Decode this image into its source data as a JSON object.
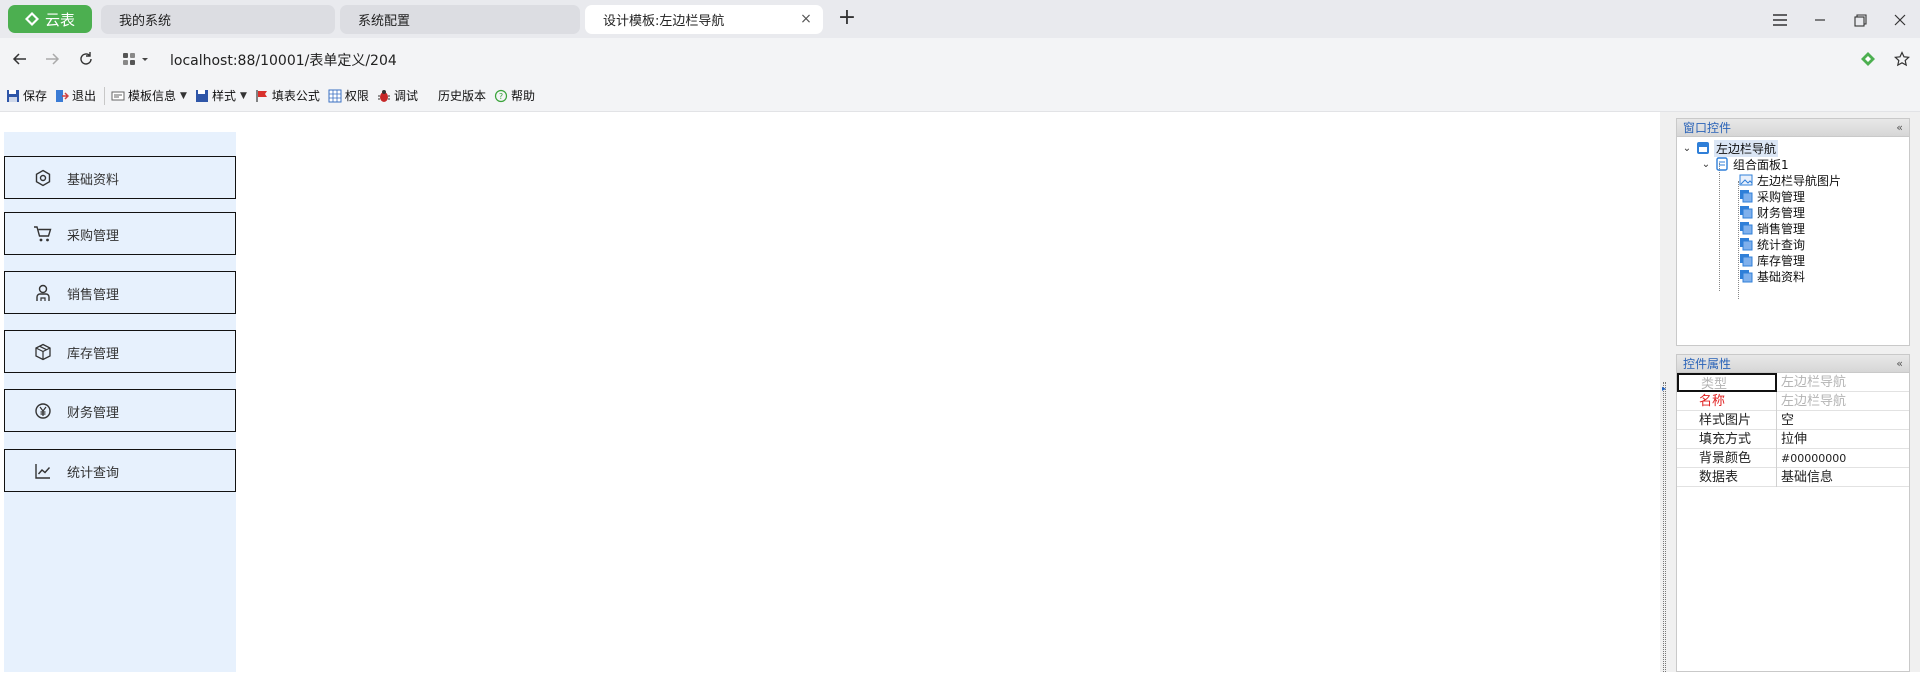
{
  "browser": {
    "app_button_label": "云表",
    "tabs": [
      {
        "label": "我的系统",
        "active": false
      },
      {
        "label": "系统配置",
        "active": false
      },
      {
        "label": "设计模板:左边栏导航",
        "active": true
      }
    ],
    "close_glyph": "×",
    "new_tab_glyph": "+",
    "url": "localhost:88/10001/表单定义/204"
  },
  "toolbar": {
    "save": "保存",
    "exit": "退出",
    "template_info": "模板信息",
    "style": "样式",
    "fill_formula": "填表公式",
    "permission": "权限",
    "debug": "调试",
    "history": "历史版本",
    "help": "帮助"
  },
  "left_nav": {
    "items": [
      {
        "label": "基础资料",
        "icon": "hexagon-settings-icon"
      },
      {
        "label": "采购管理",
        "icon": "cart-icon"
      },
      {
        "label": "销售管理",
        "icon": "person-icon"
      },
      {
        "label": "库存管理",
        "icon": "box-icon"
      },
      {
        "label": "财务管理",
        "icon": "yen-coin-icon"
      },
      {
        "label": "统计查询",
        "icon": "line-chart-icon"
      }
    ]
  },
  "controls_panel": {
    "title": "窗口控件",
    "collapse_glyph": "«",
    "root": "左边栏导航",
    "group": "组合面板1",
    "children": [
      "左边栏导航图片",
      "采购管理",
      "财务管理",
      "销售管理",
      "统计查询",
      "库存管理",
      "基础资料"
    ]
  },
  "props_panel": {
    "title": "控件属性",
    "collapse_glyph": "«",
    "rows": [
      {
        "name": "类型",
        "value": "左边栏导航"
      },
      {
        "name": "名称",
        "value": "左边栏导航"
      },
      {
        "name": "样式图片",
        "value": "空"
      },
      {
        "name": "填充方式",
        "value": "拉伸"
      },
      {
        "name": "背景颜色",
        "value": "#00000000"
      },
      {
        "name": "数据表",
        "value": "基础信息"
      }
    ]
  },
  "colors": {
    "app_green": "#4caf50",
    "nav_bg": "#e7f1fd",
    "panel_title": "#2a63b8",
    "required_red": "#e02020"
  }
}
